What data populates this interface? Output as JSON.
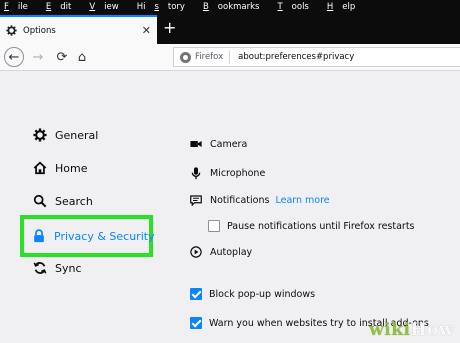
{
  "menu": {
    "items": [
      {
        "pre": "",
        "u": "F",
        "post": "ile"
      },
      {
        "pre": "",
        "u": "E",
        "post": "dit"
      },
      {
        "pre": "",
        "u": "V",
        "post": "iew"
      },
      {
        "pre": "Hi",
        "u": "s",
        "post": "tory"
      },
      {
        "pre": "",
        "u": "B",
        "post": "ookmarks"
      },
      {
        "pre": "",
        "u": "T",
        "post": "ools"
      },
      {
        "pre": "",
        "u": "H",
        "post": "elp"
      }
    ]
  },
  "tab": {
    "title": "Options",
    "close": "✕",
    "new_tab": "+"
  },
  "nav": {
    "back": "←",
    "forward": "→",
    "reload": "⟳",
    "home": "⌂"
  },
  "urlbar": {
    "identity": "Firefox",
    "url": "about:preferences#privacy"
  },
  "sidebar": {
    "general": "General",
    "home": "Home",
    "search": "Search",
    "privacy": "Privacy & Security",
    "sync": "Sync"
  },
  "permissions": {
    "camera": "Camera",
    "microphone": "Microphone",
    "notifications": "Notifications",
    "learn_more": "Learn more",
    "pause_notifications": "Pause notifications until Firefox restarts",
    "pause_checked": false,
    "autoplay": "Autoplay"
  },
  "checkboxes": {
    "block_popups": "Block pop-up windows",
    "block_popups_checked": true,
    "warn_addons": "Warn you when websites try to install add-ons",
    "warn_addons_checked": true
  },
  "colors": {
    "accent": "#0a84ff",
    "highlight": "#2be125"
  },
  "watermark": {
    "wiki": "wiki",
    "how": "How"
  }
}
